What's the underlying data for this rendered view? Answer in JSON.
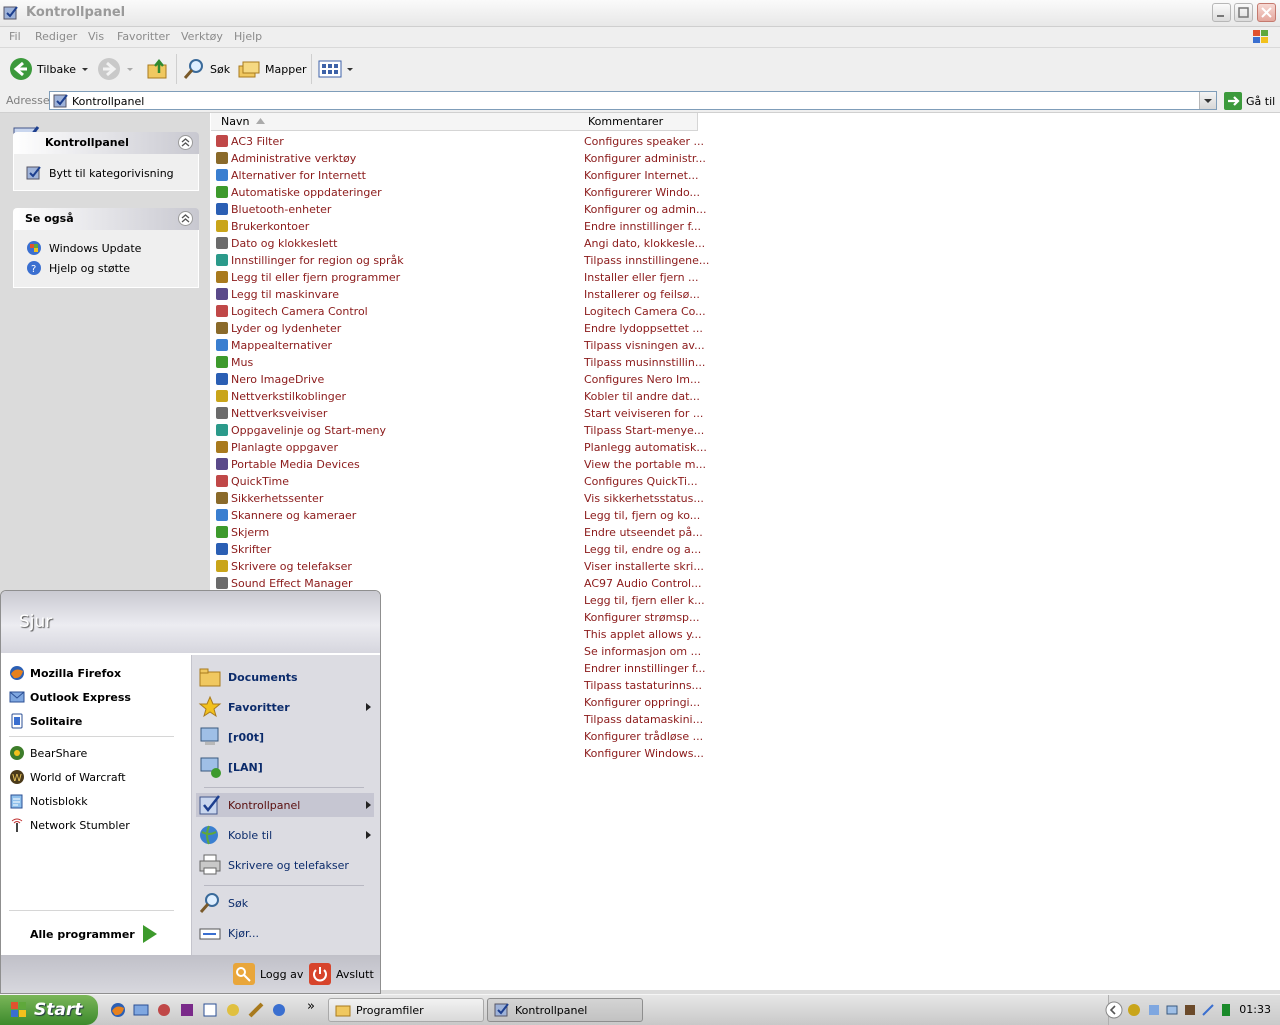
{
  "window": {
    "title": "Kontrollpanel"
  },
  "menubar": [
    "Fil",
    "Rediger",
    "Vis",
    "Favoritter",
    "Verktøy",
    "Hjelp"
  ],
  "toolbar": {
    "back": "Tilbake",
    "search": "Søk",
    "folders": "Mapper"
  },
  "address": {
    "label": "Adresse",
    "value": "Kontrollpanel",
    "go": "Gå til"
  },
  "leftpane": {
    "panel1": {
      "title": "Kontrollpanel",
      "items": [
        "Bytt til kategorivisning"
      ]
    },
    "panel2": {
      "title": "Se også",
      "items": [
        "Windows Update",
        "Hjelp og støtte"
      ]
    }
  },
  "columns": {
    "name": "Navn",
    "comment": "Kommentarer"
  },
  "rows": [
    {
      "name": "AC3 Filter",
      "comment": "Configures speaker ..."
    },
    {
      "name": "Administrative verktøy",
      "comment": "Konfigurer administr..."
    },
    {
      "name": "Alternativer for Internett",
      "comment": "Konfigurer Internet..."
    },
    {
      "name": "Automatiske oppdateringer",
      "comment": "Konfigurerer Windo..."
    },
    {
      "name": "Bluetooth-enheter",
      "comment": "Konfigurer og admin..."
    },
    {
      "name": "Brukerkontoer",
      "comment": "Endre innstillinger f..."
    },
    {
      "name": "Dato og klokkeslett",
      "comment": "Angi dato, klokkesle..."
    },
    {
      "name": "Innstillinger for region og språk",
      "comment": "Tilpass innstillingene..."
    },
    {
      "name": "Legg til eller fjern programmer",
      "comment": "Installer eller fjern ..."
    },
    {
      "name": "Legg til maskinvare",
      "comment": "Installerer og feilsø..."
    },
    {
      "name": "Logitech Camera Control",
      "comment": "Logitech Camera Co..."
    },
    {
      "name": "Lyder og lydenheter",
      "comment": "Endre lydoppsettet ..."
    },
    {
      "name": "Mappealternativer",
      "comment": "Tilpass visningen av..."
    },
    {
      "name": "Mus",
      "comment": "Tilpass musinnstillin..."
    },
    {
      "name": "Nero ImageDrive",
      "comment": "Configures Nero Im..."
    },
    {
      "name": "Nettverkstilkoblinger",
      "comment": "Kobler til andre dat..."
    },
    {
      "name": "Nettverksveiviser",
      "comment": "Start veiviseren for ..."
    },
    {
      "name": "Oppgavelinje og Start-meny",
      "comment": "Tilpass Start-menye..."
    },
    {
      "name": "Planlagte oppgaver",
      "comment": "Planlegg automatisk..."
    },
    {
      "name": "Portable Media Devices",
      "comment": "View the portable m..."
    },
    {
      "name": "QuickTime",
      "comment": "Configures QuickTi..."
    },
    {
      "name": "Sikkerhetssenter",
      "comment": "Vis sikkerhetsstatus..."
    },
    {
      "name": "Skannere og kameraer",
      "comment": "Legg til, fjern og ko..."
    },
    {
      "name": "Skjerm",
      "comment": "Endre utseendet på..."
    },
    {
      "name": "Skrifter",
      "comment": "Legg til, endre og a..."
    },
    {
      "name": "Skrivere og telefakser",
      "comment": "Viser installerte skri..."
    },
    {
      "name": "Sound Effect Manager",
      "comment": "AC97 Audio Control..."
    },
    {
      "name": "",
      "comment": "Legg til, fjern eller k..."
    },
    {
      "name": "",
      "comment": "Konfigurer strømsp..."
    },
    {
      "name": "",
      "comment": "This applet allows y..."
    },
    {
      "name": "",
      "comment": "Se informasjon om ..."
    },
    {
      "name": "",
      "comment": "Endrer innstillinger f..."
    },
    {
      "name": "",
      "comment": "Tilpass tastaturinns..."
    },
    {
      "name": "",
      "comment": "Konfigurer oppringi..."
    },
    {
      "name": "",
      "comment": "Tilpass datamaskini..."
    },
    {
      "name": "",
      "comment": "Konfigurer trådløse ..."
    },
    {
      "name": "",
      "comment": "Konfigurer Windows..."
    }
  ],
  "startmenu": {
    "user": "Sjur",
    "pinned": [
      "Mozilla Firefox",
      "Outlook Express",
      "Solitaire"
    ],
    "recent": [
      "BearShare",
      "World of Warcraft",
      "Notisblokk",
      "Network Stumbler"
    ],
    "all_programs": "Alle programmer",
    "right": [
      "Documents",
      "Favoritter",
      "[r00t]",
      "[LAN]",
      "Kontrollpanel",
      "Koble til",
      "Skrivere og telefakser",
      "Søk",
      "Kjør..."
    ],
    "logoff": "Logg av",
    "shutdown": "Avslutt"
  },
  "taskbar": {
    "start": "Start",
    "more": "»",
    "buttons": [
      "Programfiler",
      "Kontrollpanel"
    ],
    "clock": "01:33"
  },
  "colors": {
    "link_red": "#8b1a1a",
    "start_green": "#3d8a2c"
  }
}
